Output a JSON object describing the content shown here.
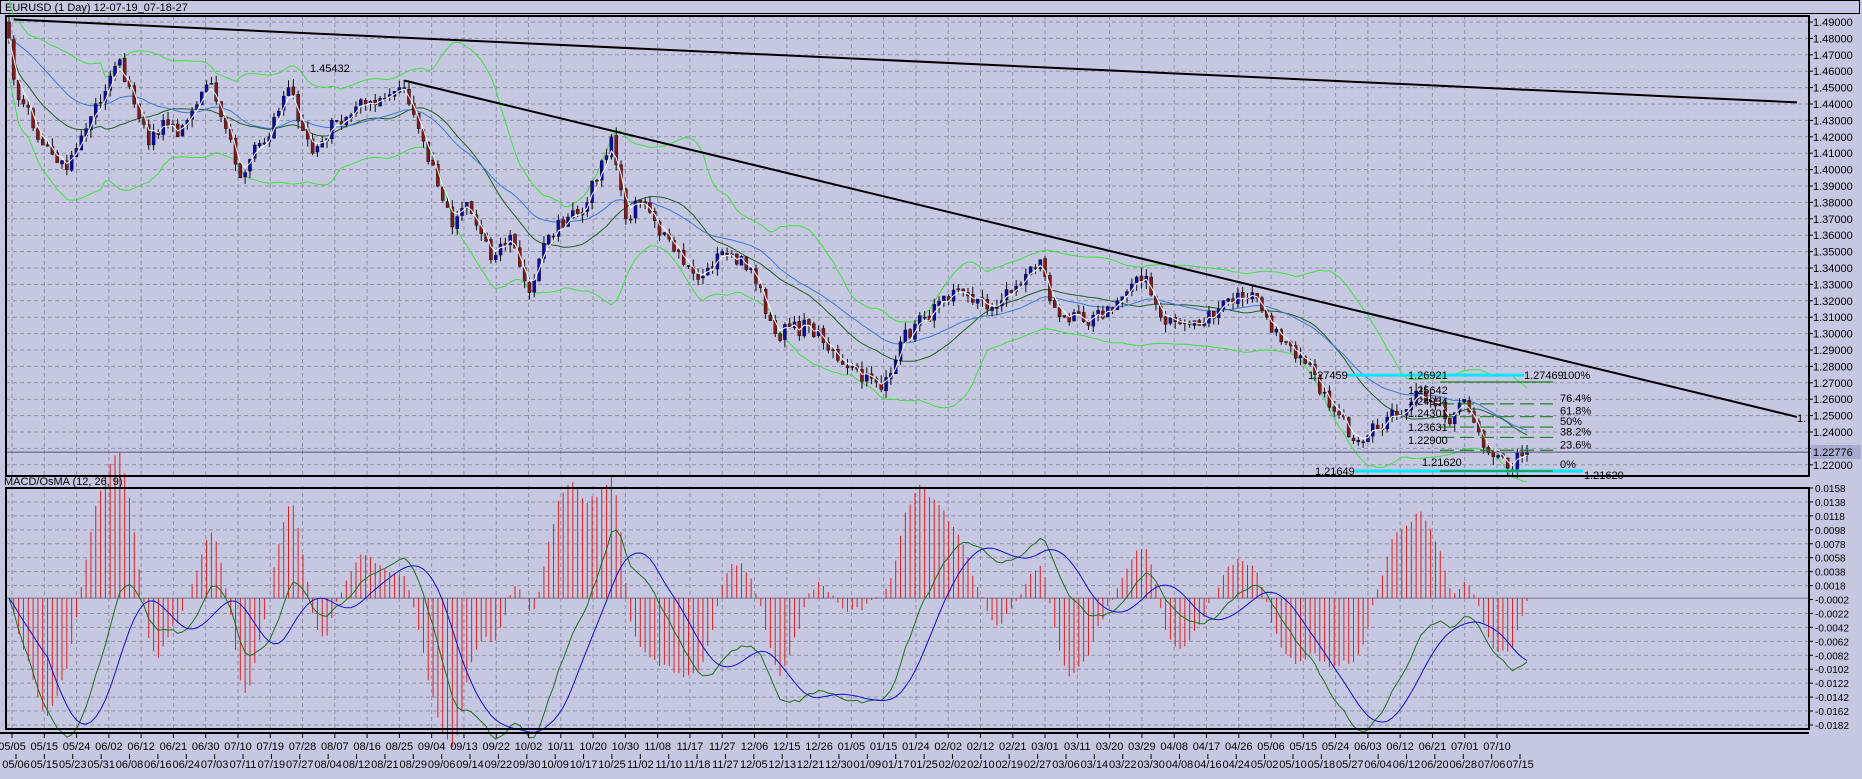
{
  "window": {
    "title": "EURUSD (1 Day) 12-07-19_07-18-27"
  },
  "indicator_panel": {
    "title": "MACD/OsMA (12, 26, 9)"
  },
  "colors": {
    "background": "#c6c8e2",
    "bull_candle": "#0a0ab0",
    "bear_candle": "#8a1818",
    "bollinger": "#40e040",
    "middle_band": "#1f5f1f",
    "slow_ma": "#3a7ad8",
    "fast_line": "#ffffff",
    "fibo_anchor": "#00e8ff",
    "fibo_level": "#1f7f1f",
    "trendline": "#000000",
    "macd_line": "#1f6f1f",
    "signal_line": "#1010d0",
    "osma_hist": "#e02020"
  },
  "chart_data": [
    {
      "type": "candlestick",
      "symbol": "EURUSD",
      "timeframe": "1 Day",
      "ylim": [
        1.215,
        1.495
      ],
      "y_ticks": [
        "1.49000",
        "1.48000",
        "1.47000",
        "1.46000",
        "1.45000",
        "1.44000",
        "1.43000",
        "1.42000",
        "1.41000",
        "1.40000",
        "1.39000",
        "1.38000",
        "1.37000",
        "1.36000",
        "1.35000",
        "1.34000",
        "1.33000",
        "1.32000",
        "1.31000",
        "1.30000",
        "1.29000",
        "1.28000",
        "1.27000",
        "1.26000",
        "1.25000",
        "1.24000",
        "1.23000",
        "1.22000"
      ],
      "current_price": "1.22776",
      "grid": true,
      "close_path": [
        [
          "2011-05-05",
          1.48
        ],
        [
          "2011-05-06",
          1.455
        ],
        [
          "2011-05-10",
          1.44
        ],
        [
          "2011-05-16",
          1.415
        ],
        [
          "2011-05-23",
          1.4
        ],
        [
          "2011-05-27",
          1.425
        ],
        [
          "2011-06-07",
          1.467
        ],
        [
          "2011-06-10",
          1.44
        ],
        [
          "2011-06-15",
          1.415
        ],
        [
          "2011-06-20",
          1.43
        ],
        [
          "2011-06-23",
          1.42
        ],
        [
          "2011-06-27",
          1.43
        ],
        [
          "2011-07-04",
          1.452
        ],
        [
          "2011-07-07",
          1.425
        ],
        [
          "2011-07-12",
          1.395
        ],
        [
          "2011-07-15",
          1.415
        ],
        [
          "2011-07-20",
          1.42
        ],
        [
          "2011-07-26",
          1.45
        ],
        [
          "2011-08-02",
          1.41
        ],
        [
          "2011-08-09",
          1.43
        ],
        [
          "2011-08-17",
          1.44
        ],
        [
          "2011-08-26",
          1.45
        ],
        [
          "2011-08-29",
          1.45
        ],
        [
          "2011-09-01",
          1.425
        ],
        [
          "2011-09-07",
          1.39
        ],
        [
          "2011-09-12",
          1.365
        ],
        [
          "2011-09-15",
          1.38
        ],
        [
          "2011-09-22",
          1.345
        ],
        [
          "2011-09-28",
          1.36
        ],
        [
          "2011-10-04",
          1.325
        ],
        [
          "2011-10-10",
          1.36
        ],
        [
          "2011-10-17",
          1.375
        ],
        [
          "2011-10-20",
          1.38
        ],
        [
          "2011-10-27",
          1.42
        ],
        [
          "2011-11-01",
          1.37
        ],
        [
          "2011-11-04",
          1.38
        ],
        [
          "2011-11-10",
          1.36
        ],
        [
          "2011-11-16",
          1.35
        ],
        [
          "2011-11-23",
          1.335
        ],
        [
          "2011-11-29",
          1.35
        ],
        [
          "2011-12-07",
          1.34
        ],
        [
          "2011-12-14",
          1.3
        ],
        [
          "2011-12-23",
          1.305
        ],
        [
          "2011-12-29",
          1.29
        ],
        [
          "2012-01-05",
          1.28
        ],
        [
          "2012-01-13",
          1.266
        ],
        [
          "2012-01-19",
          1.295
        ],
        [
          "2012-01-26",
          1.31
        ],
        [
          "2012-02-02",
          1.32
        ],
        [
          "2012-02-07",
          1.326
        ],
        [
          "2012-02-14",
          1.315
        ],
        [
          "2012-02-21",
          1.325
        ],
        [
          "2012-02-29",
          1.345
        ],
        [
          "2012-03-02",
          1.32
        ],
        [
          "2012-03-07",
          1.31
        ],
        [
          "2012-03-14",
          1.305
        ],
        [
          "2012-03-22",
          1.32
        ],
        [
          "2012-03-30",
          1.335
        ],
        [
          "2012-04-04",
          1.31
        ],
        [
          "2012-04-10",
          1.306
        ],
        [
          "2012-04-16",
          1.305
        ],
        [
          "2012-04-23",
          1.32
        ],
        [
          "2012-05-01",
          1.325
        ],
        [
          "2012-05-04",
          1.31
        ],
        [
          "2012-05-09",
          1.295
        ],
        [
          "2012-05-14",
          1.285
        ],
        [
          "2012-05-18",
          1.275
        ],
        [
          "2012-05-23",
          1.255
        ],
        [
          "2012-05-31",
          1.235
        ],
        [
          "2012-06-05",
          1.245
        ],
        [
          "2012-06-12",
          1.25
        ],
        [
          "2012-06-18",
          1.265
        ],
        [
          "2012-06-21",
          1.26
        ],
        [
          "2012-06-27",
          1.245
        ],
        [
          "2012-07-02",
          1.26
        ],
        [
          "2012-07-05",
          1.24
        ],
        [
          "2012-07-10",
          1.225
        ],
        [
          "2012-07-13",
          1.218
        ],
        [
          "2012-07-19",
          1.2278
        ]
      ],
      "trendlines": [
        {
          "from": [
            "2011-05-06",
            1.4915
          ],
          "to_right_edge": 1.441
        },
        {
          "from": [
            "2011-08-29",
            1.45432
          ],
          "to_right_edge": 1.2492
        }
      ],
      "annotations": [
        "1.45432",
        "1.27459",
        "1.26921",
        "1.25642",
        "1.24934",
        "1.24301",
        "1.23631",
        "1.22900",
        "1.21620",
        "1.21649",
        "1.27469",
        "1.21620",
        "1."
      ],
      "fibonacci": {
        "high": 1.26982,
        "low": 1.2162,
        "anchor_high_label": "1.27469",
        "anchor_low_label": "1.21620",
        "levels": [
          {
            "label": "100%",
            "ratio": 1.0
          },
          {
            "label": "76.4%",
            "ratio": 0.764
          },
          {
            "label": "61.8%",
            "ratio": 0.618
          },
          {
            "label": "50%",
            "ratio": 0.5
          },
          {
            "label": "38.2%",
            "ratio": 0.382
          },
          {
            "label": "23.6%",
            "ratio": 0.236
          },
          {
            "label": "0%",
            "ratio": 0.0
          }
        ]
      }
    },
    {
      "type": "line+bar",
      "title": "MACD/OsMA (12, 26, 9)",
      "params": {
        "fast": 12,
        "slow": 26,
        "signal": 9
      },
      "ylim": [
        -0.0182,
        0.0158
      ],
      "y_ticks": [
        "0.0158",
        "0.0138",
        "0.0118",
        "0.0098",
        "0.0078",
        "0.0058",
        "0.0038",
        "0.0018",
        "-0.0002",
        "-0.0022",
        "-0.0042",
        "-0.0062",
        "-0.0082",
        "-0.0102",
        "-0.0122",
        "-0.0142",
        "-0.0162",
        "-0.0182"
      ]
    }
  ],
  "x_axis": {
    "top_labels": [
      "05/05",
      "05/15",
      "05/24",
      "06/02",
      "06/12",
      "06/21",
      "06/30",
      "07/10",
      "07/19",
      "07/28",
      "08/07",
      "08/16",
      "08/25",
      "09/04",
      "09/13",
      "09/22",
      "10/02",
      "10/11",
      "10/20",
      "10/30",
      "11/08",
      "11/17",
      "11/27",
      "12/06",
      "12/15",
      "12/26",
      "01/05",
      "01/15",
      "01/24",
      "02/02",
      "02/12",
      "02/21",
      "03/01",
      "03/11",
      "03/20",
      "03/29",
      "04/08",
      "04/17",
      "04/26",
      "05/06",
      "05/15",
      "05/24",
      "06/03",
      "06/12",
      "06/21",
      "07/01",
      "07/10"
    ],
    "bottom_labels": [
      "05/06",
      "05/15",
      "05/23",
      "05/31",
      "06/08",
      "06/16",
      "06/24",
      "07/03",
      "07/11",
      "07/19",
      "07/27",
      "08/04",
      "08/12",
      "08/21",
      "08/29",
      "09/06",
      "09/14",
      "09/22",
      "09/30",
      "10/09",
      "10/17",
      "10/25",
      "11/02",
      "11/10",
      "11/18",
      "11/27",
      "12/05",
      "12/13",
      "12/21",
      "12/30",
      "01/09",
      "01/17",
      "01/25",
      "02/02",
      "02/10",
      "02/19",
      "02/27",
      "03/06",
      "03/14",
      "03/22",
      "03/30",
      "04/08",
      "04/16",
      "04/24",
      "05/02",
      "05/10",
      "05/18",
      "05/27",
      "06/04",
      "06/12",
      "06/20",
      "06/28",
      "07/06",
      "07/15"
    ]
  }
}
